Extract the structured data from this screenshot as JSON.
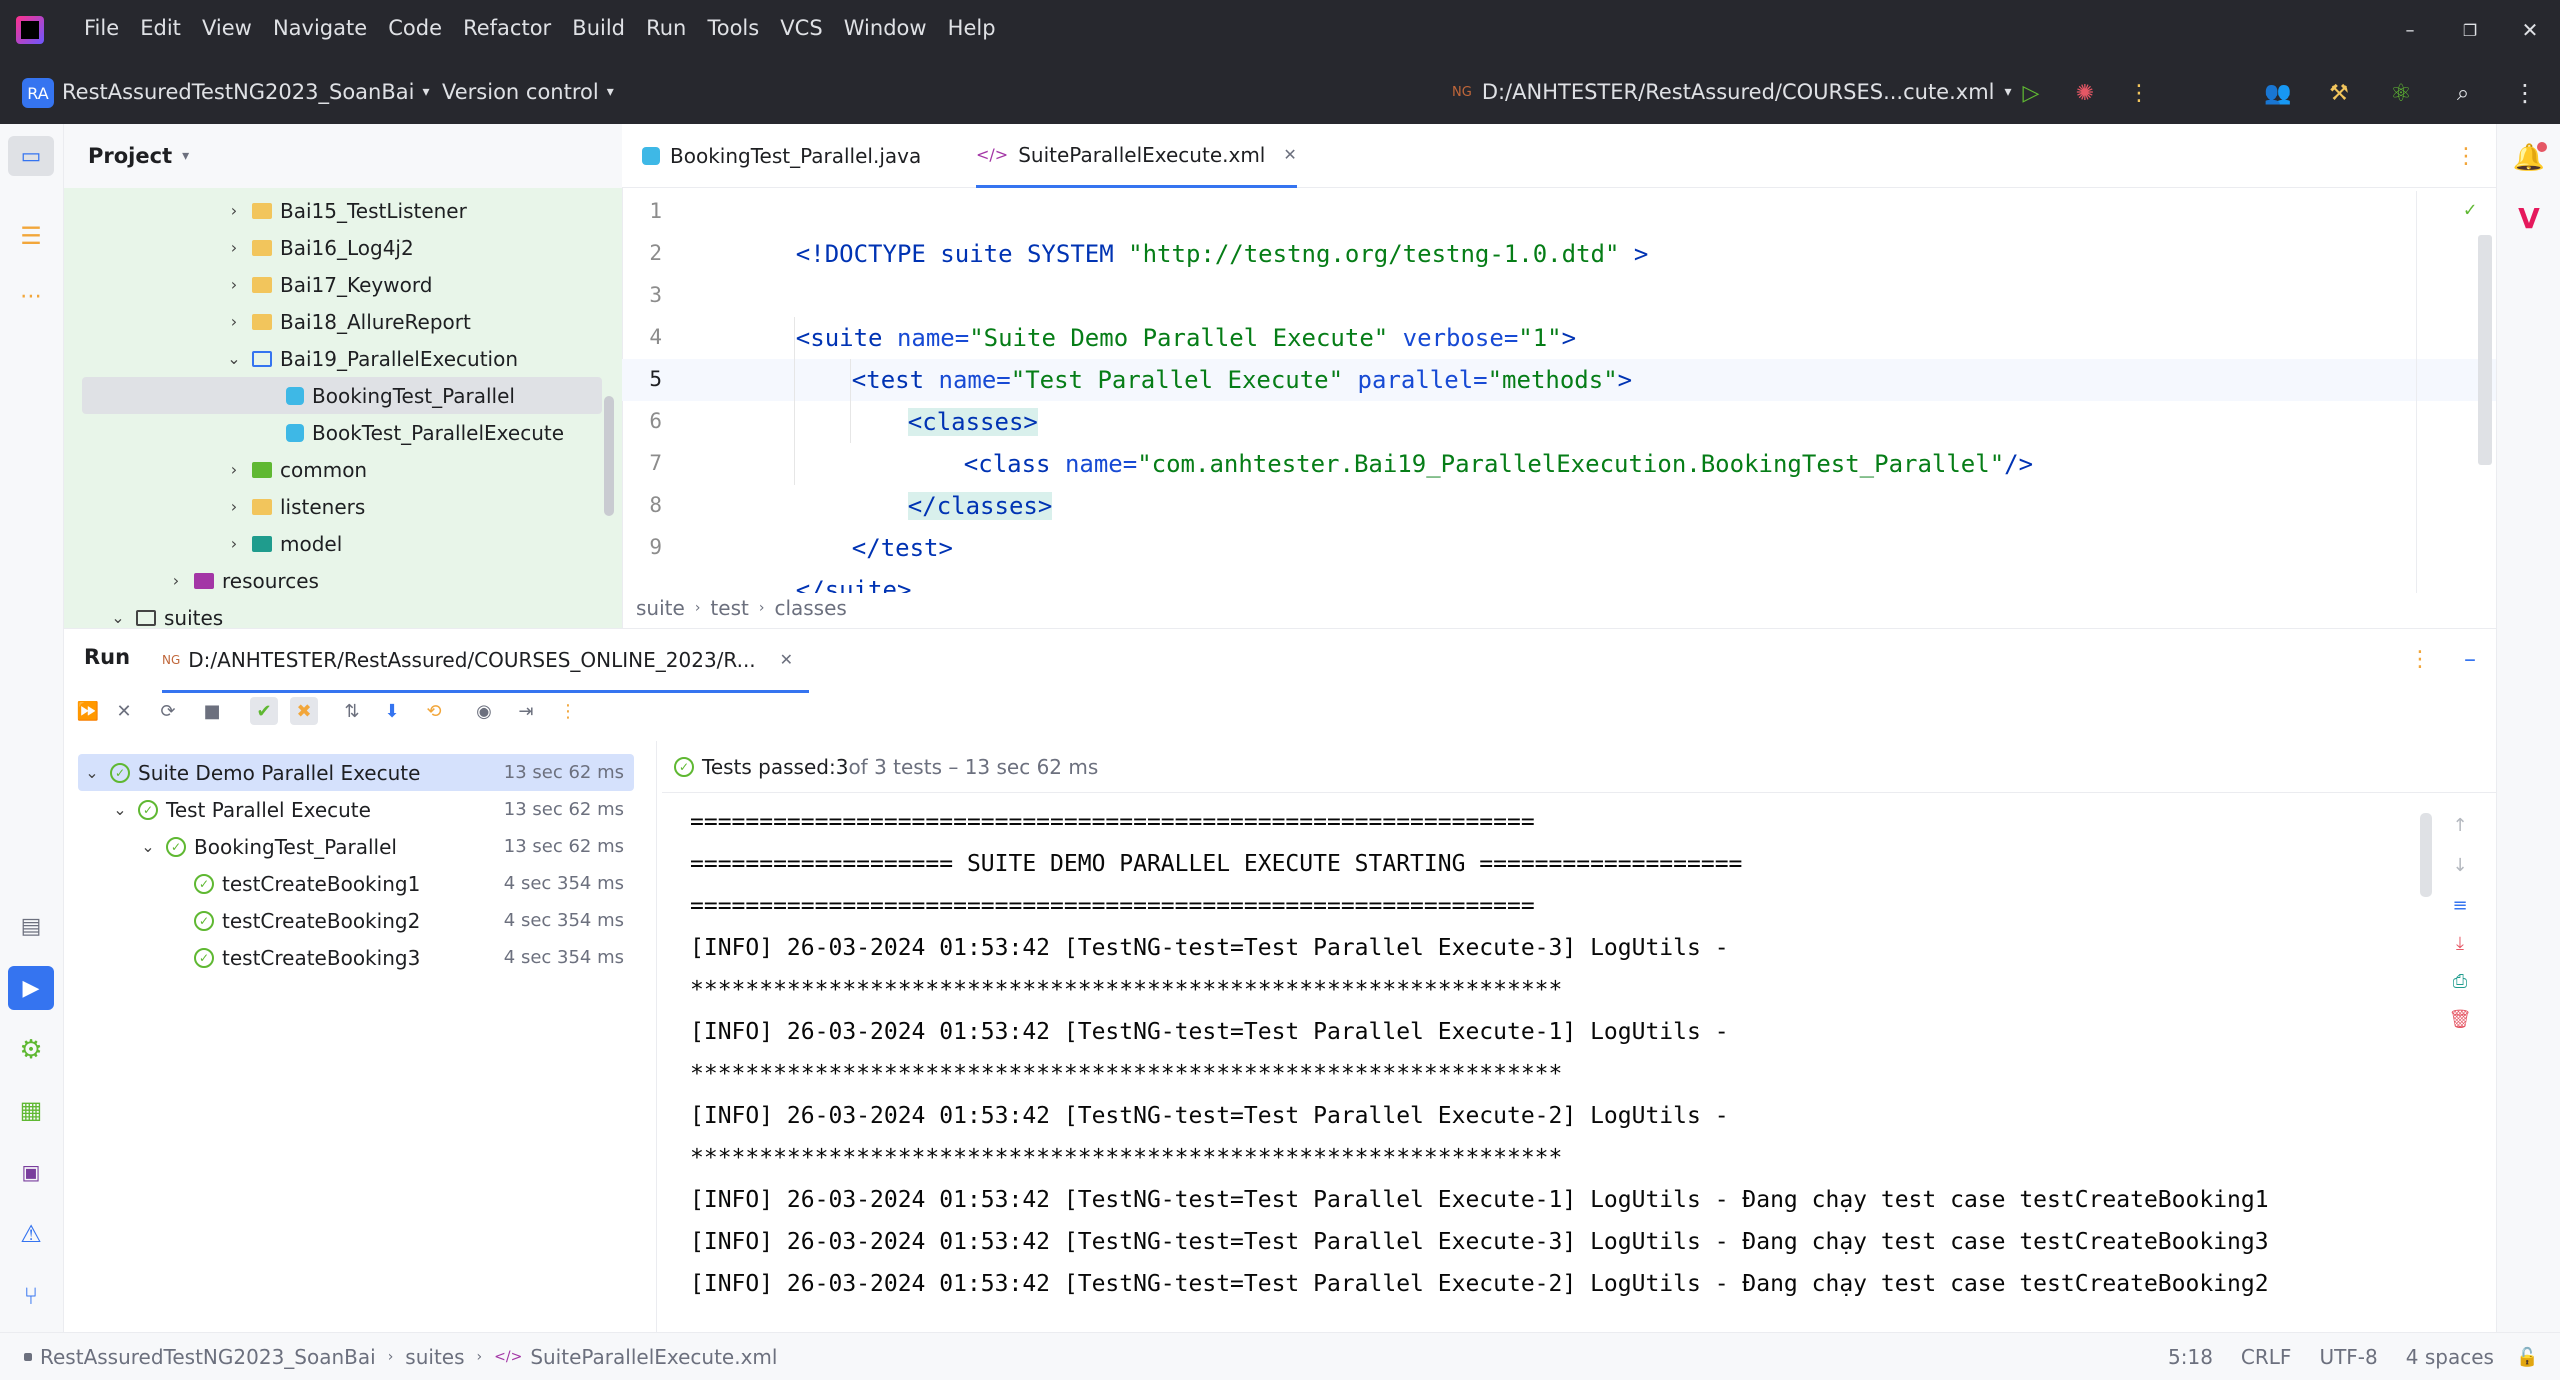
{
  "titlebar": {
    "menu": [
      "File",
      "Edit",
      "View",
      "Navigate",
      "Code",
      "Refactor",
      "Build",
      "Run",
      "Tools",
      "VCS",
      "Window",
      "Help"
    ]
  },
  "toolbar": {
    "project_badge": "RA",
    "project_name": "RestAssuredTestNG2023_SoanBai",
    "vcs_label": "Version control",
    "run_config": "D:/ANHTESTER/RestAssured/COURSES...cute.xml"
  },
  "project_panel": {
    "title": "Project",
    "items": [
      {
        "label": "Bai15_TestListener",
        "type": "folder"
      },
      {
        "label": "Bai16_Log4j2",
        "type": "folder"
      },
      {
        "label": "Bai17_Keyword",
        "type": "folder"
      },
      {
        "label": "Bai18_AllureReport",
        "type": "folder"
      },
      {
        "label": "Bai19_ParallelExecution",
        "type": "folder-open"
      },
      {
        "label": "BookingTest_Parallel",
        "type": "class"
      },
      {
        "label": "BookTest_ParallelExecute",
        "type": "class"
      },
      {
        "label": "common",
        "type": "folder"
      },
      {
        "label": "listeners",
        "type": "folder"
      },
      {
        "label": "model",
        "type": "folder"
      },
      {
        "label": "resources",
        "type": "resources"
      },
      {
        "label": "suites",
        "type": "folder-open"
      }
    ]
  },
  "editor": {
    "tabs": [
      {
        "label": "BookingTest_Parallel.java"
      },
      {
        "label": "SuiteParallelExecute.xml"
      }
    ],
    "line_numbers": [
      "1",
      "2",
      "3",
      "4",
      "5",
      "6",
      "7",
      "8",
      "9"
    ],
    "code": {
      "l1_doctype": "<!DOCTYPE suite SYSTEM ",
      "l1_url": "\"http://testng.org/testng-1.0.dtd\"",
      "l1_end": " >",
      "l3_open": "<suite ",
      "l3_name_attr": "name=",
      "l3_name_val": "\"Suite Demo Parallel Execute\"",
      "l3_verbose_attr": " verbose=",
      "l3_verbose_val": "\"1\"",
      "l3_close": ">",
      "l4_open": "<test ",
      "l4_name_attr": "name=",
      "l4_name_val": "\"Test Parallel Execute\"",
      "l4_parallel_attr": " parallel=",
      "l4_parallel_val": "\"methods\"",
      "l4_close": ">",
      "l5": "<classes>",
      "l6_open": "<class ",
      "l6_name_attr": "name=",
      "l6_name_val": "\"com.anhtester.Bai19_ParallelExecution.BookingTest_Parallel\"",
      "l6_close": "/>",
      "l7": "</classes>",
      "l8": "</test>",
      "l9": "</suite>"
    },
    "breadcrumb": [
      "suite",
      "test",
      "classes"
    ]
  },
  "run_panel": {
    "title": "Run",
    "tab_label": "D:/ANHTESTER/RestAssured/COURSES_ONLINE_2023/R...",
    "summary_label": "Tests passed: ",
    "summary_count": "3",
    "summary_rest": " of 3 tests – 13 sec 62 ms",
    "tests": [
      {
        "label": "Suite Demo Parallel Execute",
        "time": "13 sec 62 ms",
        "level": 0
      },
      {
        "label": "Test Parallel Execute",
        "time": "13 sec 62 ms",
        "level": 1
      },
      {
        "label": "BookingTest_Parallel",
        "time": "13 sec 62 ms",
        "level": 2
      },
      {
        "label": "testCreateBooking1",
        "time": "4 sec 354 ms",
        "level": 3
      },
      {
        "label": "testCreateBooking2",
        "time": "4 sec 354 ms",
        "level": 3
      },
      {
        "label": "testCreateBooking3",
        "time": "4 sec 354 ms",
        "level": 3
      }
    ],
    "console": [
      "=============================================================",
      "=================== SUITE DEMO PARALLEL EXECUTE STARTING ===================",
      "=============================================================",
      "[INFO] 26-03-2024 01:53:42 [TestNG-test=Test Parallel Execute-3] LogUtils -",
      "***************************************************************",
      "[INFO] 26-03-2024 01:53:42 [TestNG-test=Test Parallel Execute-1] LogUtils -",
      "***************************************************************",
      "[INFO] 26-03-2024 01:53:42 [TestNG-test=Test Parallel Execute-2] LogUtils -",
      "***************************************************************",
      "[INFO] 26-03-2024 01:53:42 [TestNG-test=Test Parallel Execute-1] LogUtils - Đang chạy test case testCreateBooking1",
      "[INFO] 26-03-2024 01:53:42 [TestNG-test=Test Parallel Execute-3] LogUtils - Đang chạy test case testCreateBooking3",
      "[INFO] 26-03-2024 01:53:42 [TestNG-test=Test Parallel Execute-2] LogUtils - Đang chạy test case testCreateBooking2"
    ]
  },
  "statusbar": {
    "path": [
      "RestAssuredTestNG2023_SoanBai",
      "suites",
      "SuiteParallelExecute.xml"
    ],
    "position": "5:18",
    "line_sep": "CRLF",
    "encoding": "UTF-8",
    "indent": "4 spaces"
  }
}
